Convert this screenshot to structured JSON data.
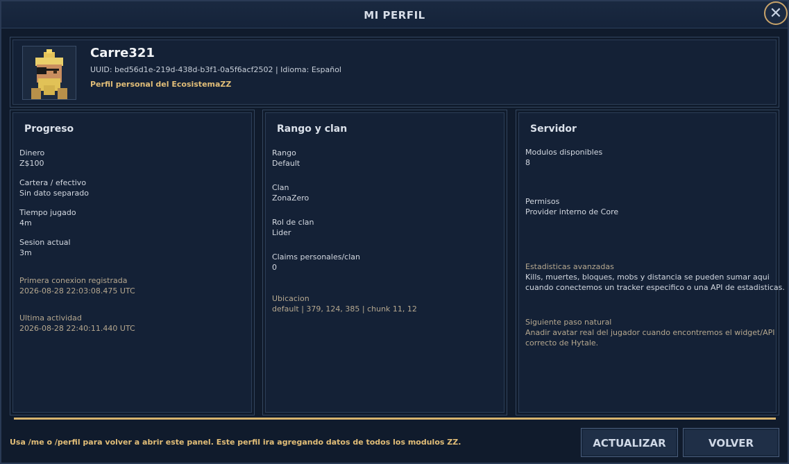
{
  "window": {
    "title": "MI PERFIL",
    "close_icon": "✕"
  },
  "profile": {
    "username": "Carre321",
    "uuid_line": "UUID: bed56d1e-219d-438d-b3f1-0a5f6acf2502 | Idioma: Español",
    "subtitle": "Perfil personal del EcosistemaZZ"
  },
  "progress": {
    "title": "Progreso",
    "items": [
      {
        "label": "Dinero",
        "value": "Z$100"
      },
      {
        "label": "Cartera / efectivo",
        "value": "Sin dato separado"
      },
      {
        "label": "Tiempo jugado",
        "value": "4m"
      },
      {
        "label": "Sesion actual",
        "value": "3m"
      },
      {
        "label": "Primera conexion registrada",
        "value": "2026-08-28 22:03:08.475 UTC"
      },
      {
        "label": "Ultima actividad",
        "value": "2026-08-28 22:40:11.440 UTC"
      }
    ]
  },
  "rank": {
    "title": "Rango y clan",
    "items": [
      {
        "label": "Rango",
        "value": "Default"
      },
      {
        "label": "Clan",
        "value": "ZonaZero"
      },
      {
        "label": "Rol de clan",
        "value": "Lider"
      },
      {
        "label": "Claims personales/clan",
        "value": "0"
      },
      {
        "label": "Ubicacion",
        "value": "default | 379, 124, 385 | chunk 11, 12"
      }
    ]
  },
  "server": {
    "title": "Servidor",
    "items": [
      {
        "label": "Modulos disponibles",
        "value": "8"
      },
      {
        "label": "Permisos",
        "value": "Provider interno de Core"
      },
      {
        "label": "Estadisticas avanzadas",
        "value1": "Kills, muertes, bloques, mobs y distancia se pueden sumar aqui",
        "value2": "cuando conectemos un tracker especifico o una API de estadisticas."
      },
      {
        "label": "Siguiente paso natural",
        "value1": "Anadir avatar real del jugador cuando encontremos el widget/API",
        "value2": "correcto de Hytale."
      }
    ]
  },
  "footer": {
    "hint": "Usa /me o /perfil para volver a abrir este panel. Este perfil ira agregando datos de todos los modulos ZZ.",
    "update_label": "ACTUALIZAR",
    "back_label": "VOLVER"
  },
  "colors": {
    "accent": "#e2be78",
    "background": "#101b2c",
    "panel": "#142136"
  }
}
